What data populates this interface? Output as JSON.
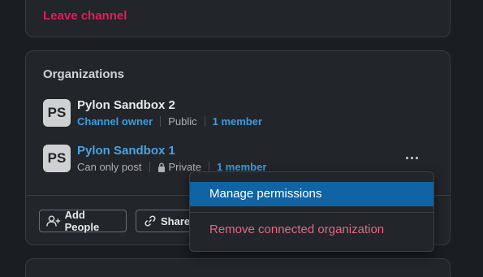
{
  "channel": {
    "leave_label": "Leave channel"
  },
  "organizations": {
    "title": "Organizations",
    "items": [
      {
        "initials": "PS",
        "name": "Pylon Sandbox 2",
        "role": "Channel owner",
        "visibility": "Public",
        "members": "1 member"
      },
      {
        "initials": "PS",
        "name": "Pylon Sandbox 1",
        "role": "Can only post",
        "visibility": "Private",
        "members": "1 member"
      }
    ]
  },
  "actions": {
    "add_people": "Add People",
    "share": "Share"
  },
  "context_menu": {
    "items": [
      {
        "label": "Manage permissions",
        "state": "highlighted"
      },
      {
        "label": "Remove connected organization",
        "state": "destructive"
      }
    ]
  },
  "colors": {
    "background": "#1a1d21",
    "card": "#222529",
    "link": "#3b9ee0",
    "danger": "#e01e5a",
    "menu_highlight": "#1164a3"
  },
  "icons": {
    "lock": "lock-icon",
    "more": "more-horizontal-icon",
    "add_person": "add-person-icon",
    "share": "link-icon"
  }
}
